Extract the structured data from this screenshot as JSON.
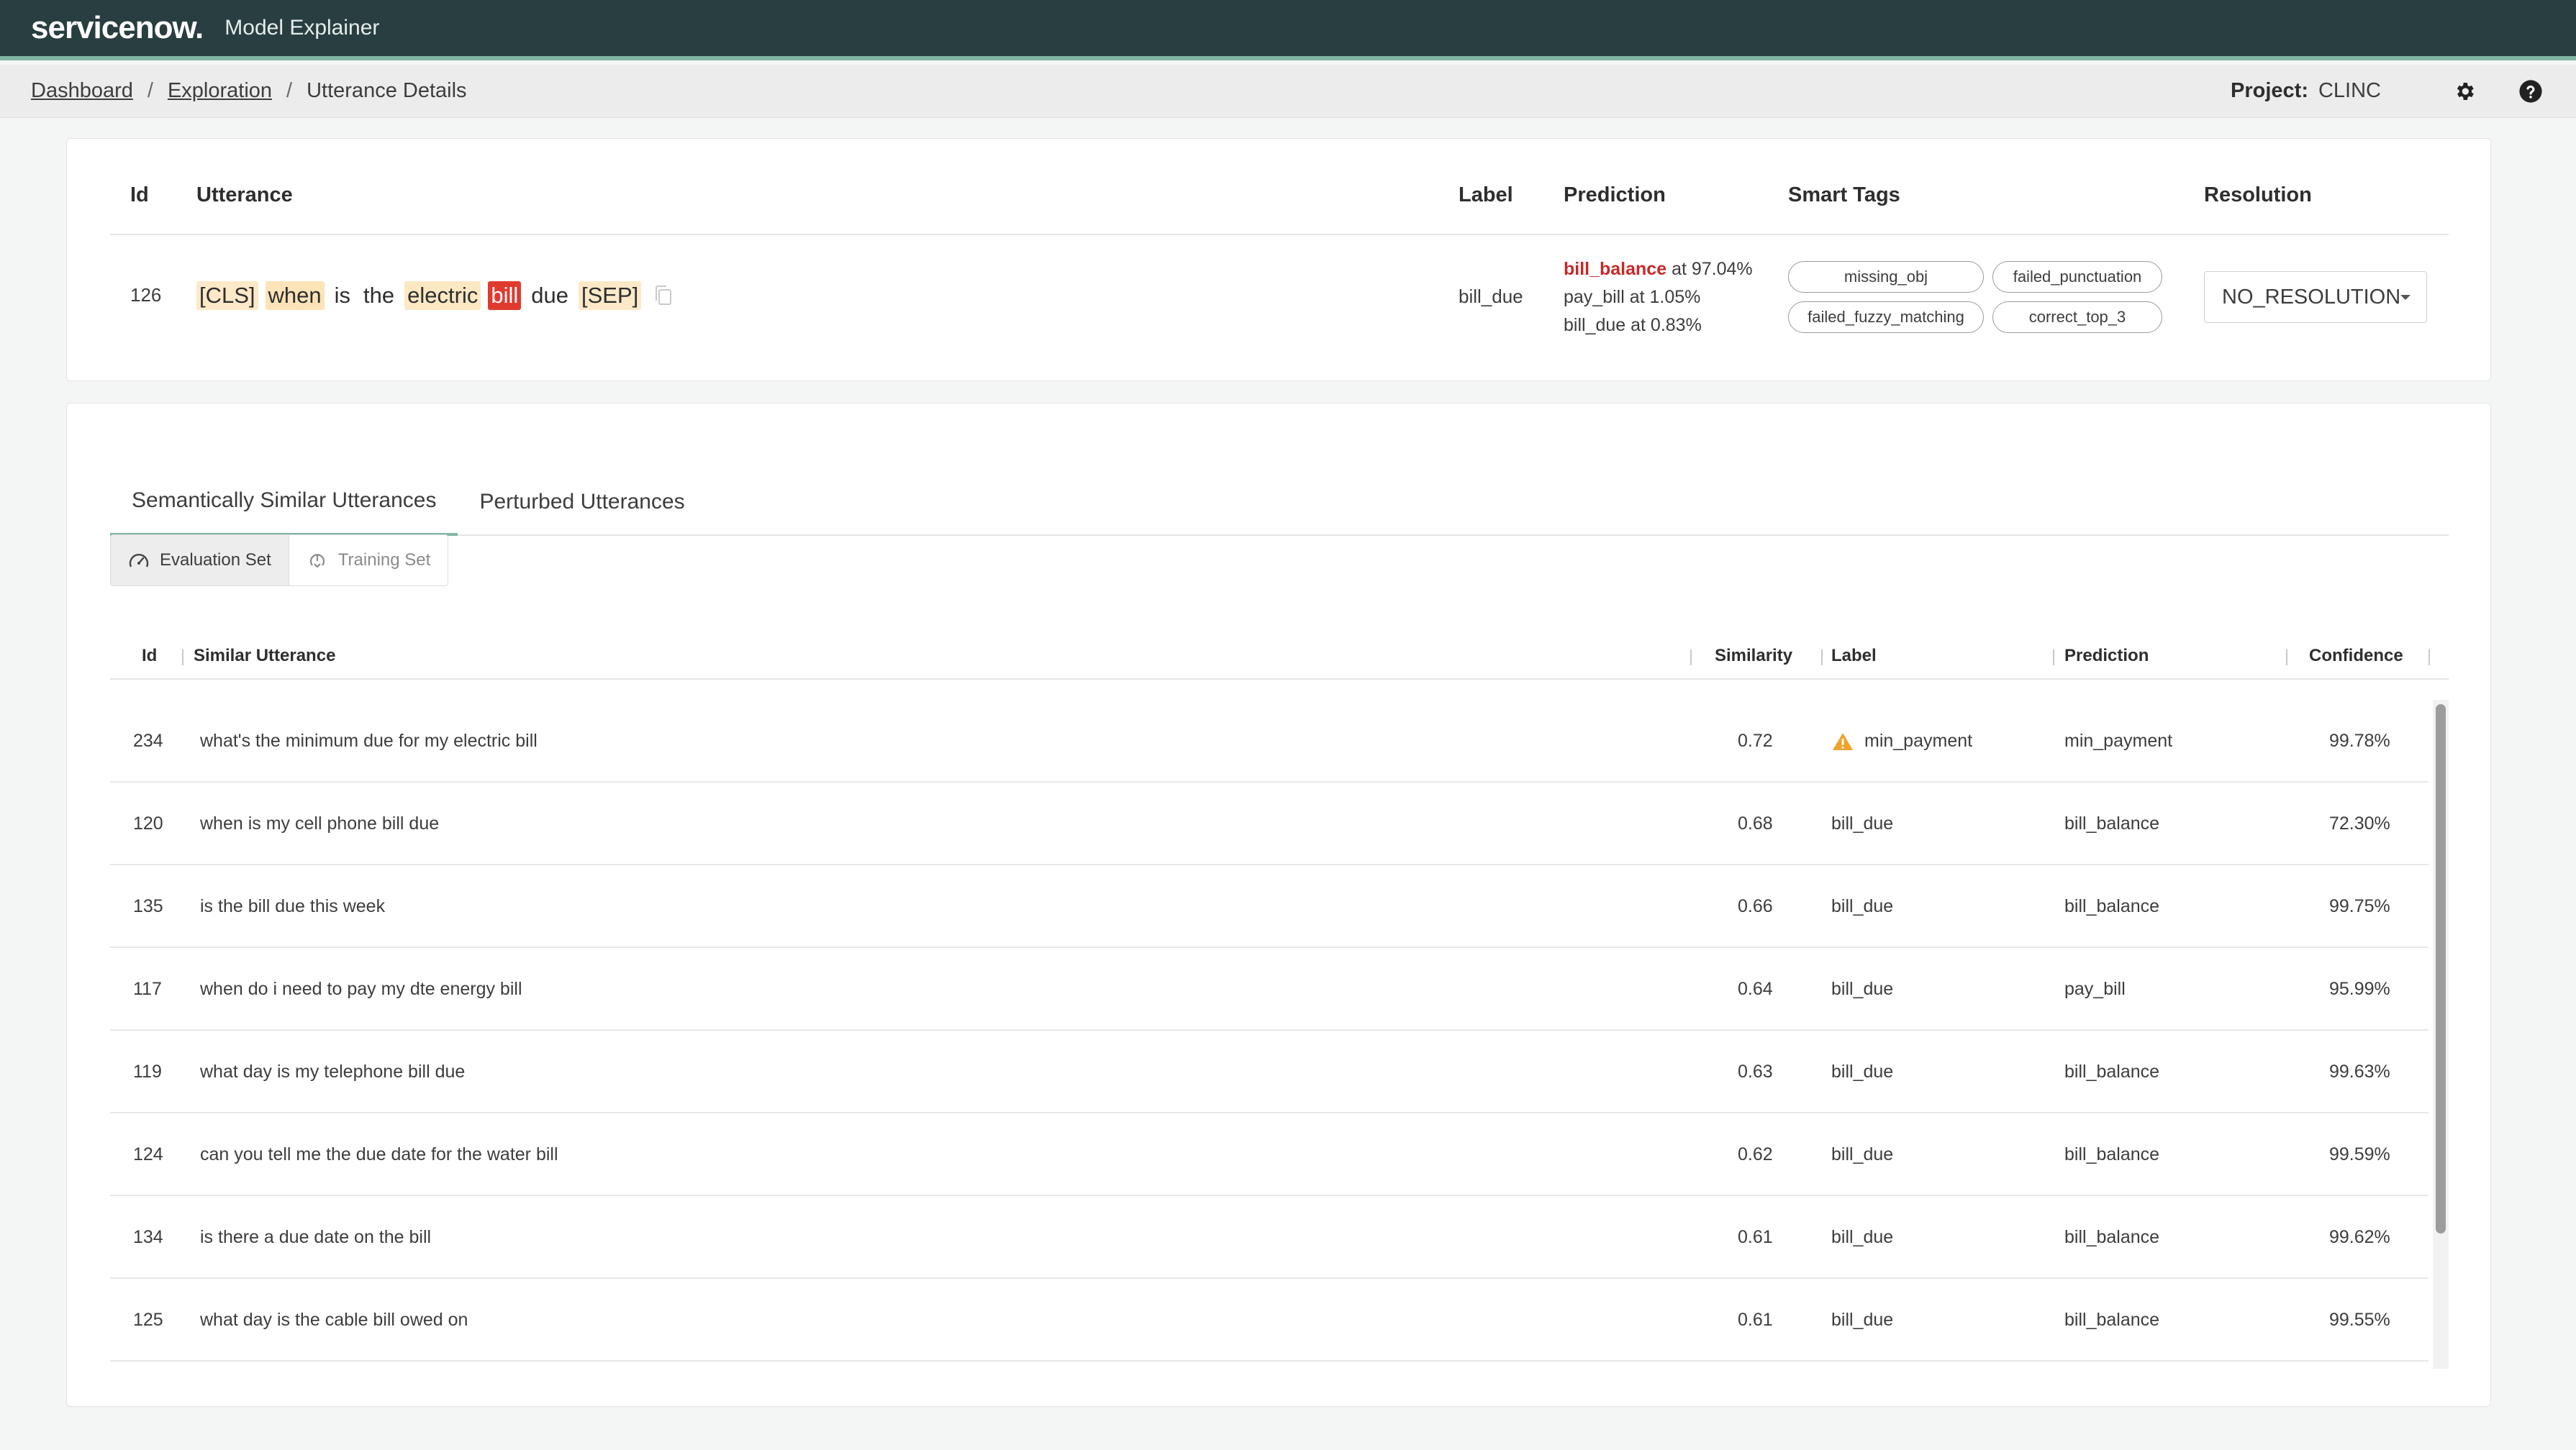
{
  "header": {
    "logo": "servicenow.",
    "app_title": "Model Explainer"
  },
  "breadcrumb": {
    "items": [
      "Dashboard",
      "Exploration"
    ],
    "current": "Utterance Details",
    "separator": "/"
  },
  "project": {
    "label": "Project:",
    "value": "CLINC"
  },
  "icons": {
    "settings": "gear-icon",
    "help": "help-icon"
  },
  "utterance_table": {
    "headers": {
      "id": "Id",
      "utterance": "Utterance",
      "label": "Label",
      "prediction": "Prediction",
      "smart_tags": "Smart Tags",
      "resolution": "Resolution"
    },
    "row": {
      "id": "126",
      "tokens": [
        "[CLS]",
        "when",
        "is",
        "the",
        "electric",
        "bill",
        "due",
        "[SEP]"
      ],
      "label": "bill_due",
      "prediction_top": "bill_balance",
      "prediction_top_suffix": " at 97.04%",
      "prediction_2": "pay_bill at 1.05%",
      "prediction_3": "bill_due at 0.83%",
      "tags": [
        "missing_obj",
        "failed_punctuation",
        "failed_fuzzy_matching",
        "correct_top_3"
      ],
      "resolution": "NO_RESOLUTION"
    }
  },
  "tabs": [
    "Semantically Similar Utterances",
    "Perturbed Utterances"
  ],
  "segments": [
    "Evaluation Set",
    "Training Set"
  ],
  "similar_table": {
    "headers": {
      "id": "Id",
      "utterance": "Similar Utterance",
      "similarity": "Similarity",
      "label": "Label",
      "prediction": "Prediction",
      "confidence": "Confidence"
    },
    "rows": [
      {
        "id": "234",
        "utterance": "what's the minimum due for my electric bill",
        "similarity": "0.72",
        "label": "min_payment",
        "prediction": "min_payment",
        "confidence": "99.78%",
        "warning": true
      },
      {
        "id": "120",
        "utterance": "when is my cell phone bill due",
        "similarity": "0.68",
        "label": "bill_due",
        "prediction": "bill_balance",
        "confidence": "72.30%"
      },
      {
        "id": "135",
        "utterance": "is the bill due this week",
        "similarity": "0.66",
        "label": "bill_due",
        "prediction": "bill_balance",
        "confidence": "99.75%"
      },
      {
        "id": "117",
        "utterance": "when do i need to pay my dte energy bill",
        "similarity": "0.64",
        "label": "bill_due",
        "prediction": "pay_bill",
        "confidence": "95.99%"
      },
      {
        "id": "119",
        "utterance": "what day is my telephone bill due",
        "similarity": "0.63",
        "label": "bill_due",
        "prediction": "bill_balance",
        "confidence": "99.63%"
      },
      {
        "id": "124",
        "utterance": "can you tell me the due date for the water bill",
        "similarity": "0.62",
        "label": "bill_due",
        "prediction": "bill_balance",
        "confidence": "99.59%"
      },
      {
        "id": "134",
        "utterance": "is there a due date on the bill",
        "similarity": "0.61",
        "label": "bill_due",
        "prediction": "bill_balance",
        "confidence": "99.62%"
      },
      {
        "id": "125",
        "utterance": "what day is the cable bill owed on",
        "similarity": "0.61",
        "label": "bill_due",
        "prediction": "bill_balance",
        "confidence": "99.55%"
      }
    ]
  },
  "colors": {
    "topbar": "#293e40",
    "accent": "#81b5a1",
    "prediction_wrong": "#c62a2a",
    "token_highlight": "#e03a2f",
    "warning": "#f0a22b"
  }
}
